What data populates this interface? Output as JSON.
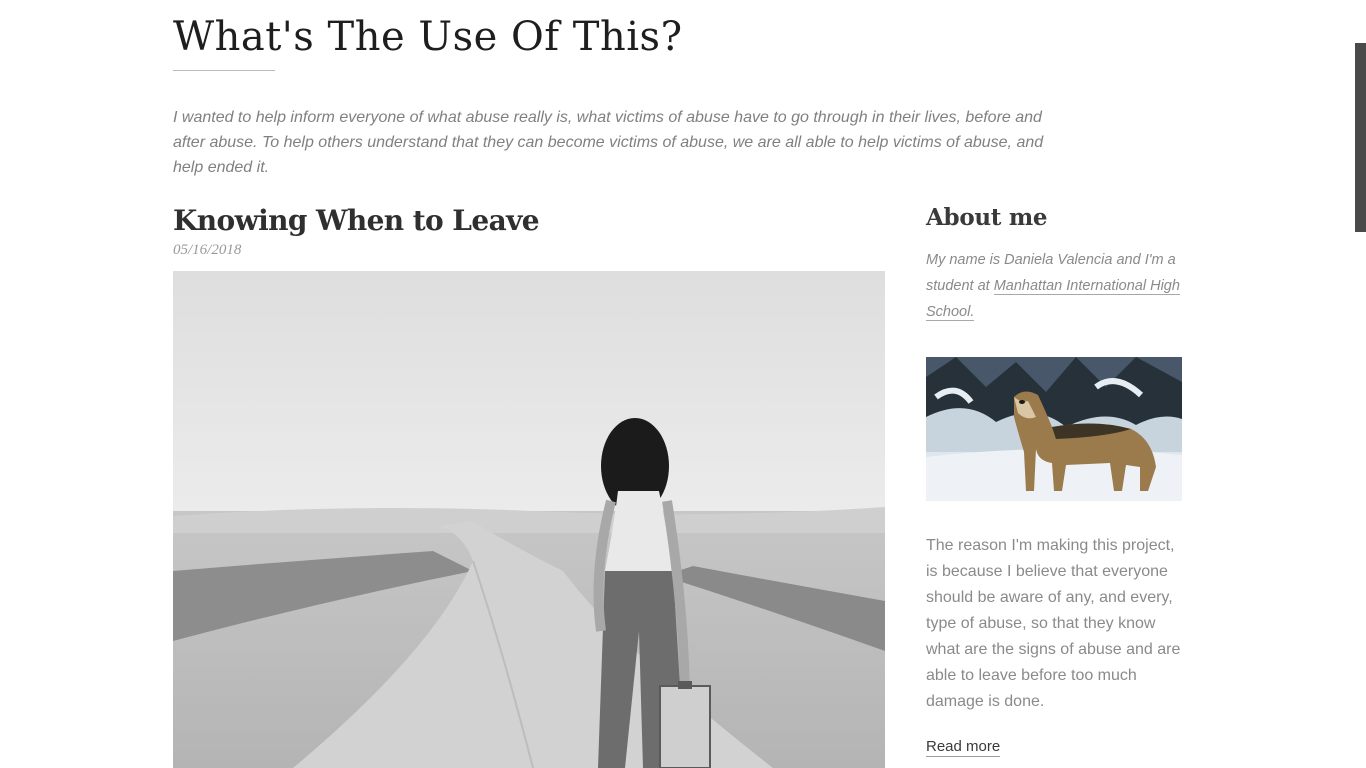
{
  "site": {
    "title": "What's The Use Of This?",
    "description": "I wanted to help inform everyone of what abuse really is, what victims of abuse have to go through in their lives, before and after abuse. To help others understand that they can become victims of abuse, we are all able to help victims of abuse, and help ended it."
  },
  "post": {
    "title": "Knowing When to Leave",
    "date": "05/16/2018",
    "image_icon": "photo-woman-walking-road-icon"
  },
  "sidebar": {
    "about_title": "About me",
    "intro_text": "My name is Daniela Valencia and I'm a student at ",
    "school_link": "Manhattan International High School.",
    "image_icon": "photo-wolf-icon",
    "body": "The reason I'm making this project, is because I believe that everyone should be aware of any, and every, type of abuse, so that they know what are the signs of abuse and are able to leave before too much damage is done.",
    "read_more": "Read more"
  },
  "colors": {
    "title": "#1e1e1e",
    "muted_text": "#8a8a8a",
    "scrollbar": "#4a4a4a"
  }
}
